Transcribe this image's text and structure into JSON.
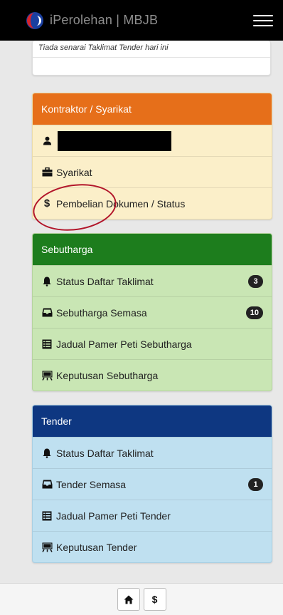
{
  "header": {
    "brand": "iPerolehan | MBJB",
    "logo_icon": "mbjb-logo-icon",
    "menu_icon": "hamburger-icon"
  },
  "top_panel": {
    "note": "Tiada senarai Taklimat Tender hari ini"
  },
  "kontraktor": {
    "heading": "Kontraktor / Syarikat",
    "color": "#e66f1a",
    "items": [
      {
        "label": "",
        "icon": "user-icon"
      },
      {
        "label": "Syarikat",
        "icon": "briefcase-icon"
      },
      {
        "label": "Pembelian Dokumen / Status",
        "icon": "dollar-icon",
        "icon_text": "$"
      }
    ]
  },
  "sebutharga": {
    "heading": "Sebutharga",
    "color": "#1d7d1d",
    "items": [
      {
        "label": "Status Daftar Taklimat",
        "icon": "bell-icon",
        "badge": "3"
      },
      {
        "label": "Sebutharga Semasa",
        "icon": "inbox-icon",
        "badge": "10"
      },
      {
        "label": "Jadual Pamer Peti Sebutharga",
        "icon": "list-alt-icon"
      },
      {
        "label": "Keputusan Sebutharga",
        "icon": "blackboard-icon"
      }
    ]
  },
  "tender": {
    "heading": "Tender",
    "color": "#0e3781",
    "items": [
      {
        "label": "Status Daftar Taklimat",
        "icon": "bell-icon"
      },
      {
        "label": "Tender Semasa",
        "icon": "inbox-icon",
        "badge": "1"
      },
      {
        "label": "Jadual Pamer Peti Tender",
        "icon": "list-alt-icon"
      },
      {
        "label": "Keputusan Tender",
        "icon": "blackboard-icon"
      }
    ]
  },
  "footer": {
    "home_icon": "home-icon",
    "dollar_label": "$"
  }
}
